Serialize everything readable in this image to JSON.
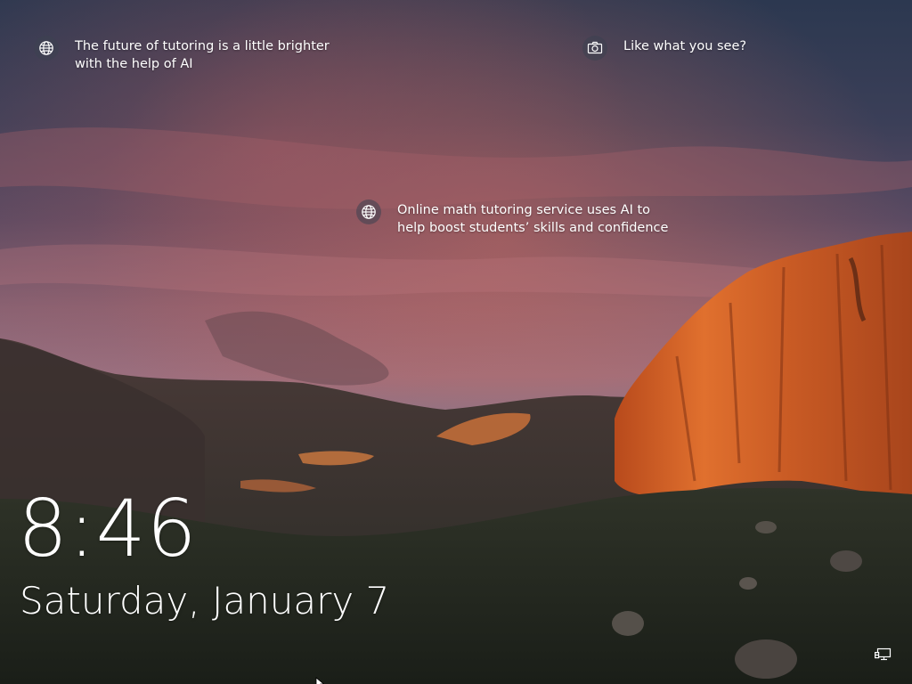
{
  "lockscreen": {
    "spotlight_left": {
      "icon": "globe-icon",
      "line1": "The future of tutoring is a little brighter",
      "line2": "with the help of AI"
    },
    "spotlight_right": {
      "icon": "camera-icon",
      "line1": "Like what you see?"
    },
    "spotlight_center": {
      "icon": "globe-icon",
      "line1": "Online math tutoring service uses AI to",
      "line2": "help boost students’ skills and confidence"
    },
    "clock": {
      "time": "8:46",
      "date": "Saturday, January 7"
    },
    "status": {
      "network_icon": "network-icon"
    }
  },
  "colors": {
    "text": "#ffffff",
    "sky_top": "#2e3a52",
    "sky_glow": "#b5605a",
    "cliff": "#d4622a",
    "ground": "#232a22"
  }
}
